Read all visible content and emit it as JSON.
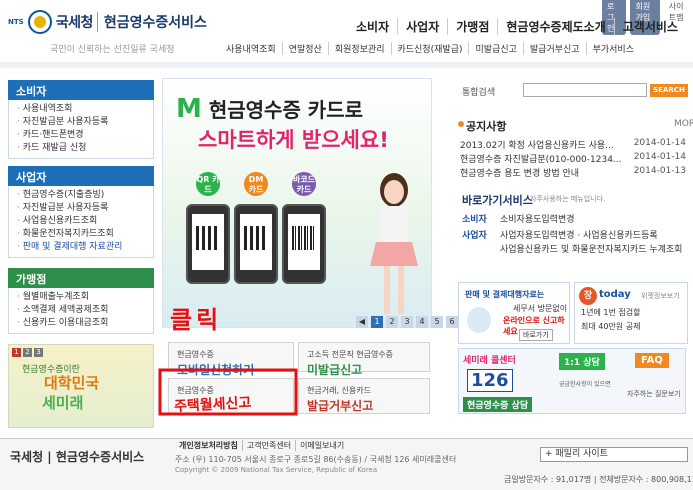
{
  "header": {
    "nts_label": "NTS",
    "brand": "국세청",
    "service": "현금영수증서비스",
    "slogan": "국민이 신뢰하는 선진일류 국세청",
    "util_buttons": [
      "로그인",
      "회원가입",
      "사이트맵"
    ],
    "gnb": [
      "소비자",
      "사업자",
      "가맹점",
      "현금영수증제도소개",
      "고객서비스"
    ],
    "subnav": [
      "사용내역조회",
      "연말정산",
      "회원정보관리",
      "카드신청(재발급)",
      "미발급신고",
      "발급거부신고",
      "부가서비스"
    ]
  },
  "left": {
    "consumer": {
      "title": "소비자",
      "items": [
        "사용내역조회",
        "자진발급분 사용자등록",
        "카드·핸드폰변경",
        "카드 재발급 신청"
      ]
    },
    "business": {
      "title": "사업자",
      "items": [
        "현금영수증(지출증빙)",
        "자진발급분 사용자등록",
        "사업용신용카드조회",
        "화물운전자복지카드조회",
        "판매 및 결제대행 자료관리"
      ]
    },
    "merchant": {
      "title": "가맹점",
      "items": [
        "월별매출누계조회",
        "소액결제 세액공제조회",
        "신용카드 이용대금조회"
      ]
    },
    "banner": {
      "nums": [
        "1",
        "2",
        "3"
      ],
      "line1": "현금영수증이란",
      "line2": "대학민국",
      "line3": "세미래"
    }
  },
  "hero": {
    "m": "M",
    "title": "현금영수증 카드로",
    "subtitle": "스마트하게 받으세요!",
    "circles": [
      "QR 카드",
      "DM 카드",
      "바코드 카드"
    ],
    "nav": [
      "1",
      "2",
      "3",
      "4",
      "5",
      "6"
    ]
  },
  "tiles": {
    "t1": {
      "small": "현금영수증",
      "big": "모바일신청하기"
    },
    "t2": {
      "small": "고소득 전문직 현금영수증",
      "big": "미발급신고"
    },
    "t3": {
      "small": "현금영수증",
      "big": "자진발급분 사용자등록"
    },
    "t4": {
      "small": "현금거래, 신용카드",
      "big": "발급거부신고"
    }
  },
  "annotation": {
    "click": "클릭",
    "handwritten": "주택월세신고"
  },
  "right": {
    "search_label": "통합검색",
    "search_btn": "SEARCH",
    "notice_title": "공지사항",
    "notice_more": "MORE",
    "notices": [
      {
        "title": "2013.02기 확정 사업용신용카드 사용...",
        "date": "2014-01-14"
      },
      {
        "title": "현금영수증 자진발급분(010-000-1234...",
        "date": "2014-01-14"
      },
      {
        "title": "현금영수증 용도 변경 방법 안내",
        "date": "2014-01-13"
      }
    ],
    "quick_title": "바로가기서비스",
    "quick_sub": "자주사용하는 메뉴입니다.",
    "quick_rows": [
      {
        "label": "소비자",
        "text": "소비자용도입력변경"
      },
      {
        "label": "사업자",
        "text": "사업자용도입력변경 · 사업용신용카드등록"
      },
      {
        "label": "",
        "text": "사업용신용카드 및 화물운전자복지카드 누계조회"
      }
    ],
    "box1": {
      "line1": "판매 및 결제대행자료는",
      "line2": "세무서 방문없이",
      "line3": "온라인으로 신고하세요",
      "more": "바로가기"
    },
    "box2": {
      "brand": "today",
      "tag": "위젯정보보기",
      "line1": "1년에 1번 점검할",
      "line2": "최대 40만원 공제"
    },
    "box3": {
      "char": "세미래 콜센터",
      "phone": "126",
      "label": "현금영수증 상담",
      "chat": "1:1 상담",
      "faq": "FAQ",
      "faq_sub": "자주하는 질문보기",
      "q": "궁금한사항이 있으면"
    }
  },
  "footer": {
    "brand": "국세청",
    "service": "현금영수증서비스",
    "links": [
      "개인정보처리방침",
      "고객만족센터",
      "이메일보내기"
    ],
    "address": "주소 (우) 110-705 서울시 종로구 종로5길 86(수송동) / 국세청 126 세미래콜센터",
    "copyright": "Copyright © 2009 National Tax Service, Republic of Korea",
    "family_site": "+ 패밀리 사이트",
    "visitors": "금일방문자수 : 91,017명  |  전체방문자수 : 800,908,114명"
  },
  "colors": {
    "primary": "#1d6fb7",
    "green": "#2e8f4a",
    "accent": "#f08a1f",
    "annotation": "#e31111"
  }
}
